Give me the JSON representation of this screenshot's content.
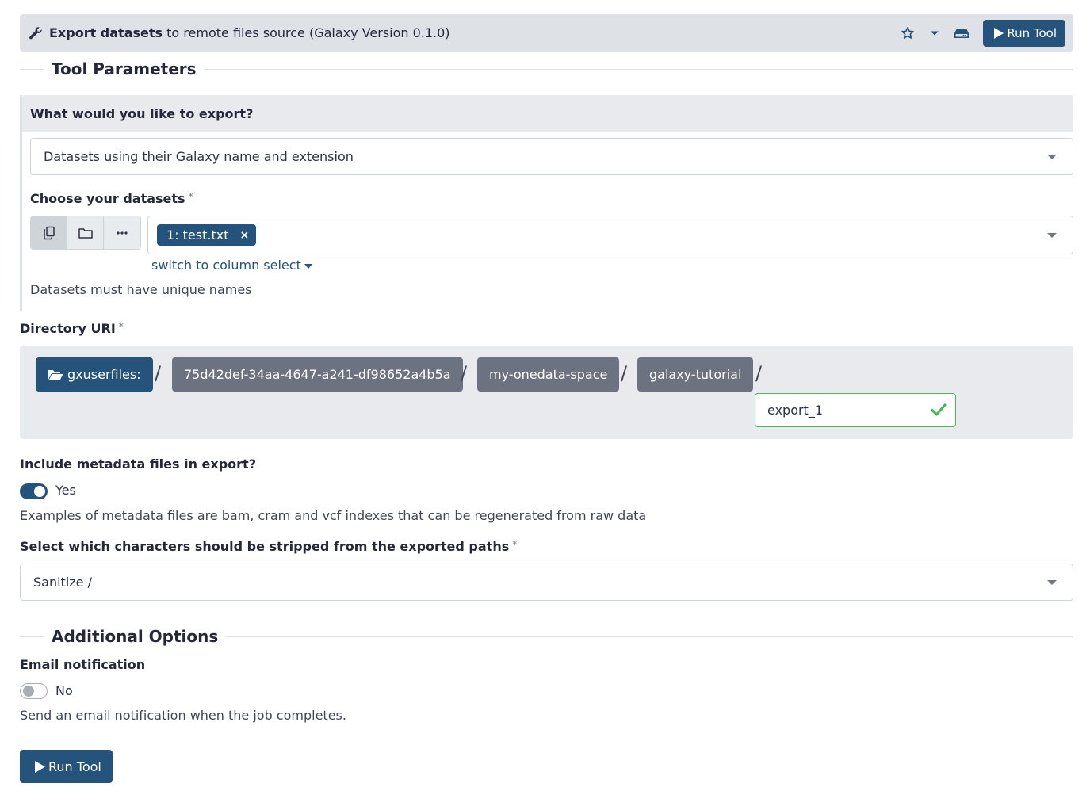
{
  "header": {
    "tool_name": "Export datasets",
    "tool_description": "to remote files source (Galaxy Version 0.1.0)",
    "run_label": "Run Tool",
    "icons": [
      "wrench-icon",
      "star-icon",
      "chevron-down-icon",
      "hdd-icon",
      "play-icon"
    ]
  },
  "sections": {
    "tool_parameters": "Tool Parameters",
    "additional_options": "Additional Options"
  },
  "export_what": {
    "label": "What would you like to export?",
    "value": "Datasets using their Galaxy name and extension"
  },
  "datasets": {
    "label": "Choose your datasets",
    "required_mark": "*",
    "source_buttons": [
      "copy-icon",
      "folder-icon",
      "ellipsis-icon"
    ],
    "selected": [
      {
        "label": "1: test.txt",
        "remove": "×"
      }
    ],
    "switch_label": "switch to column select",
    "help": "Datasets must have unique names"
  },
  "directory_uri": {
    "label": "Directory URI",
    "required_mark": "*",
    "root": "gxuserfiles:",
    "segments": [
      "75d42def-34aa-4647-a241-df98652a4b5a",
      "my-onedata-space",
      "galaxy-tutorial"
    ],
    "separator": "/",
    "input_value": "export_1"
  },
  "metadata": {
    "label": "Include metadata files in export?",
    "toggle_state": "Yes",
    "help": "Examples of metadata files are bam, cram and vcf indexes that can be regenerated from raw data"
  },
  "strip_chars": {
    "label": "Select which characters should be stripped from the exported paths",
    "required_mark": "*",
    "value": "Sanitize /"
  },
  "email": {
    "label": "Email notification",
    "toggle_state": "No",
    "help": "Send an email notification when the job completes."
  },
  "footer": {
    "run_label": "Run Tool"
  },
  "colors": {
    "primary": "#25537b",
    "segment": "#6c7280",
    "success": "#46b85a",
    "panel": "#e8eaed",
    "header": "#dee2e6"
  }
}
